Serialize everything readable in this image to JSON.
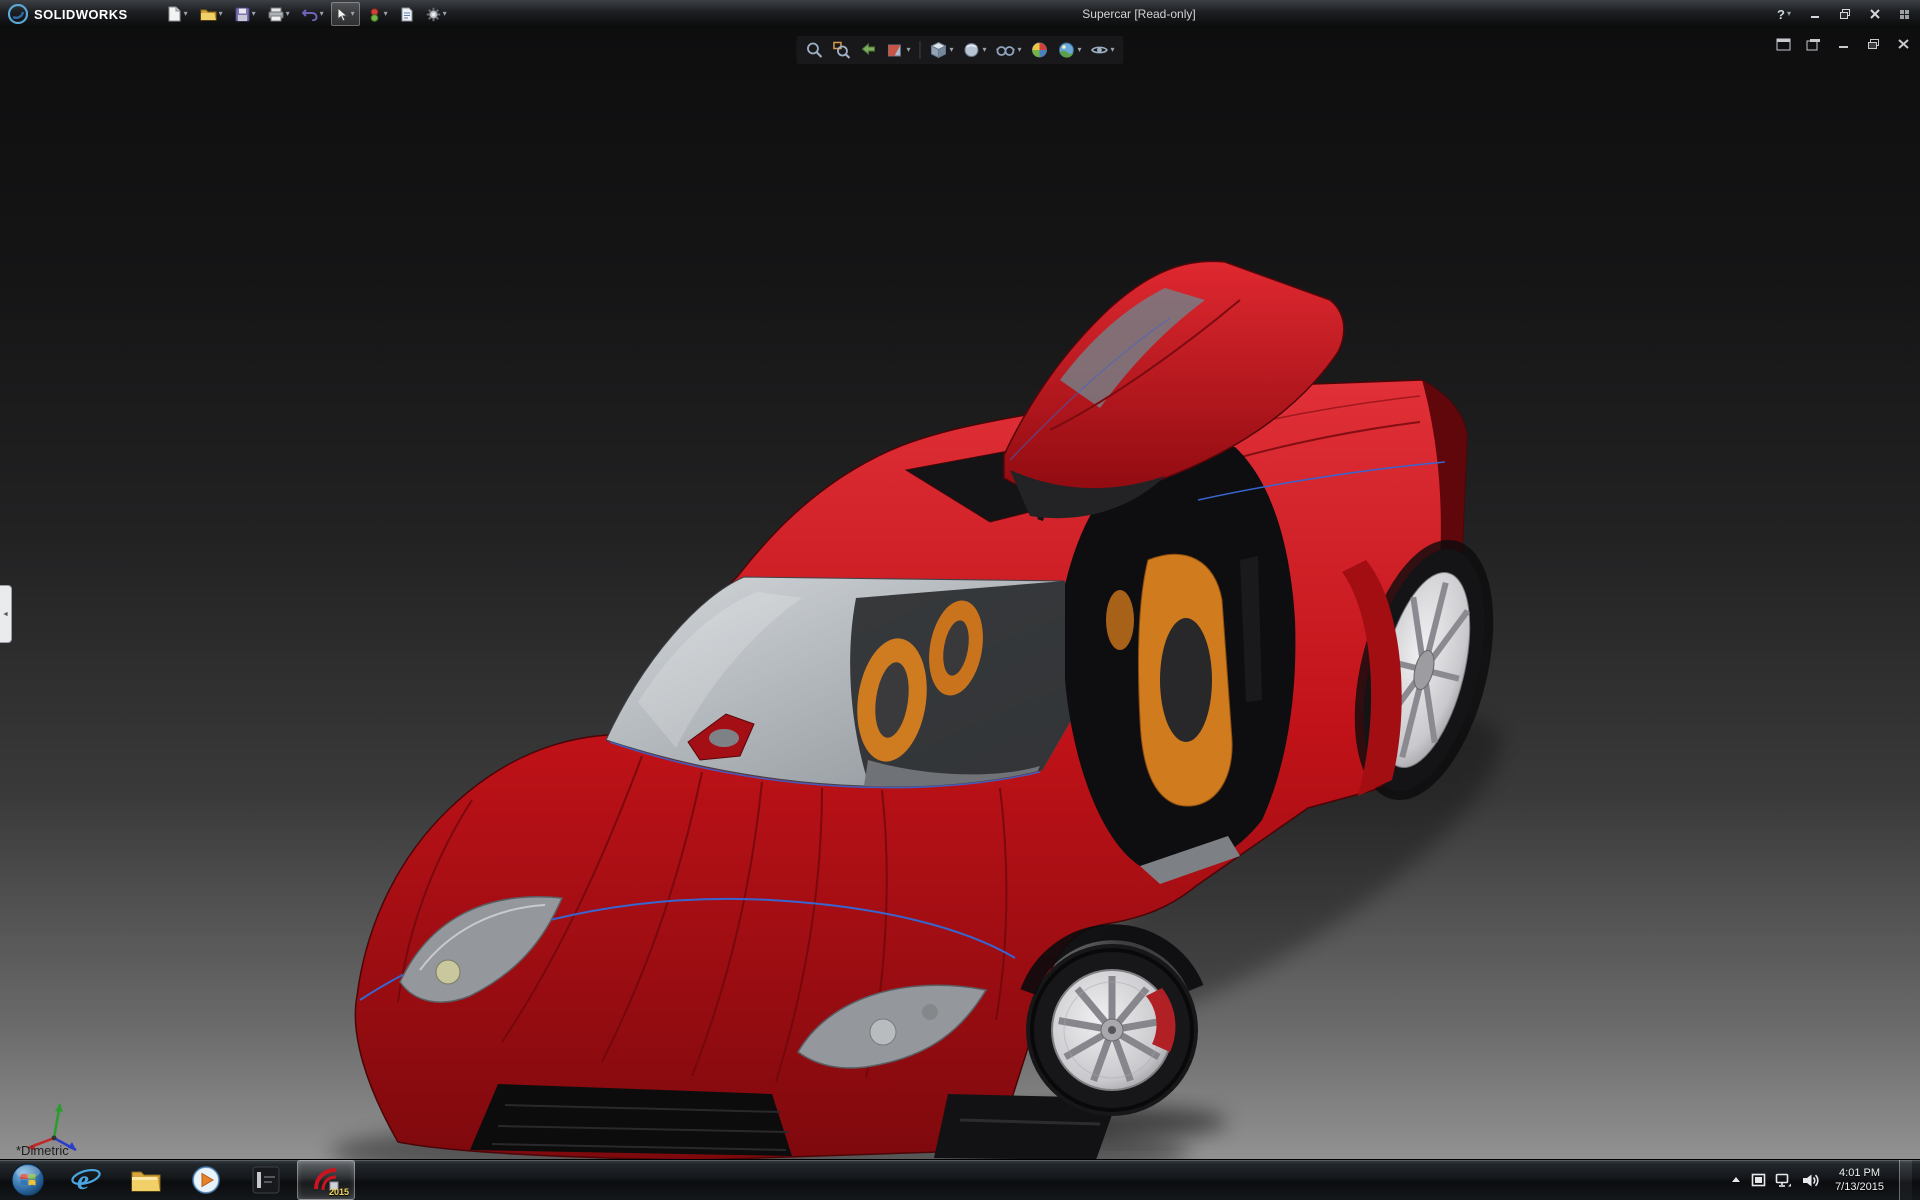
{
  "title_bar": {
    "brand": "SOLIDWORKS",
    "title": "Supercar [Read-only]",
    "help_label": "?"
  },
  "quick_access_toolbar": {
    "icons": [
      "new-document-icon",
      "open-folder-icon",
      "save-icon",
      "print-icon",
      "undo-icon",
      "select-cursor-icon",
      "rebuild-icon",
      "file-properties-icon",
      "options-icon"
    ]
  },
  "heads_up_toolbar": {
    "icons": [
      "zoom-to-fit-icon",
      "zoom-to-area-icon",
      "previous-view-icon",
      "section-view-icon",
      "view-orientation-icon",
      "display-style-icon",
      "hide-show-items-icon",
      "edit-appearance-icon",
      "apply-scene-icon",
      "view-settings-icon"
    ]
  },
  "document_window_controls": {
    "icons": [
      "restore-pane-icon",
      "new-window-icon",
      "doc-minimize-icon",
      "doc-restore-icon",
      "doc-close-icon"
    ]
  },
  "viewport": {
    "orientation_label": "*Dimetric",
    "scene": "red-supercar-3d-model-open-butterfly-door"
  },
  "taskbar": {
    "pinned_apps": [
      "start-button",
      "internet-explorer",
      "windows-explorer",
      "media-player",
      "pinned-dark-app",
      "solidworks-2015"
    ],
    "solidworks_badge": "2015",
    "tray_time": "4:01 PM",
    "tray_date": "7/13/2015"
  },
  "colors": {
    "car_red": "#c01218",
    "seat_orange": "#d07b1e",
    "edge_blue": "#3865cf",
    "glass_gray": "#c3c7ca"
  }
}
